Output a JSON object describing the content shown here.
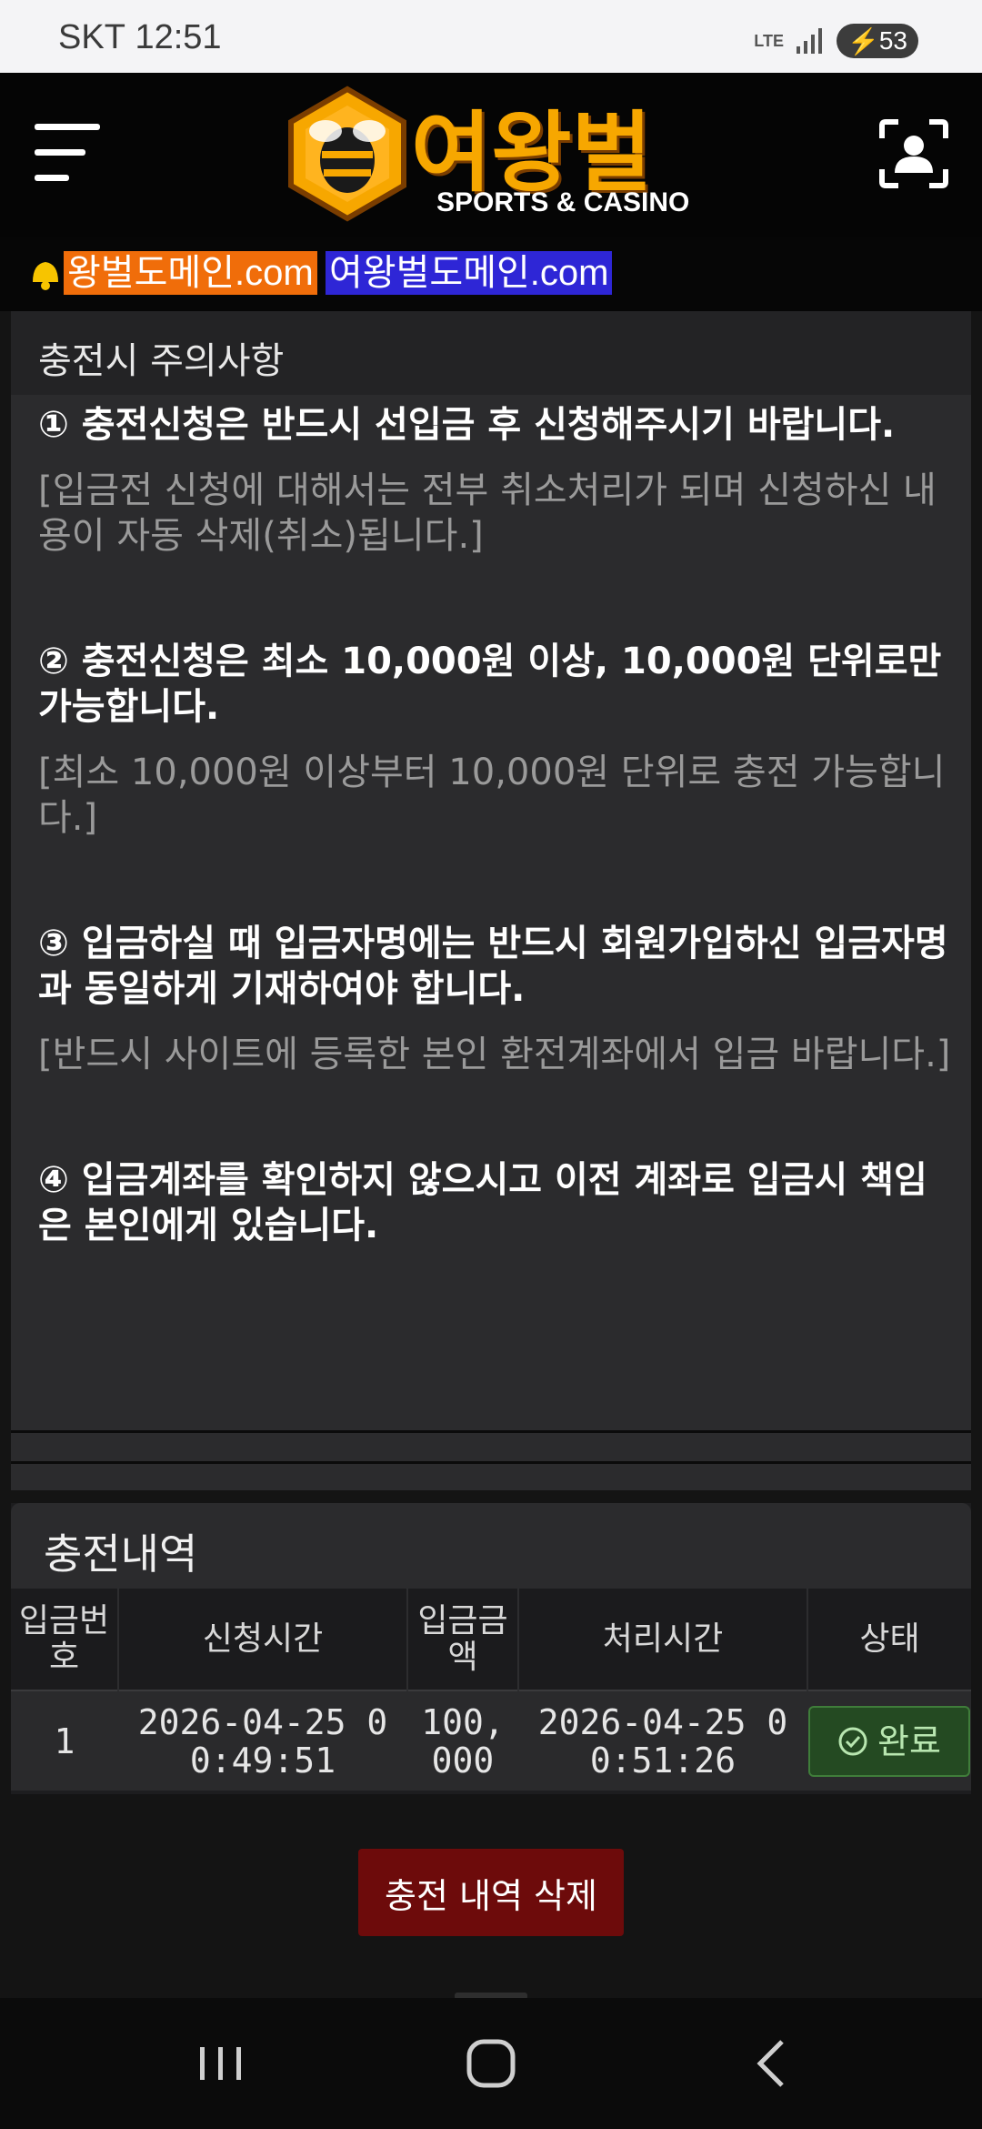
{
  "status": {
    "carrier": "SKT",
    "time": "12:51",
    "network": "LTE",
    "battery": "53"
  },
  "header": {
    "logo_text": "여왕벌",
    "logo_sub": "SPORTS & CASINO"
  },
  "domains": {
    "primary": "왕벌도메인.com",
    "secondary": "여왕벌도메인.com"
  },
  "notice": {
    "title": "충전시 주의사항",
    "items": [
      {
        "heading": "① 충전신청은 반드시 선입금 후 신청해주시기 바랍니다.",
        "sub": "[입금전 신청에 대해서는 전부 취소처리가 되며 신청하신 내용이 자동 삭제(취소)됩니다.]"
      },
      {
        "heading": "② 충전신청은 최소 10,000원 이상, 10,000원 단위로만 가능합니다.",
        "sub": "[최소 10,000원 이상부터 10,000원 단위로 충전 가능합니다.]"
      },
      {
        "heading": "③ 입금하실 때 입금자명에는 반드시 회원가입하신 입금자명과 동일하게 기재하여야 합니다.",
        "sub": "[반드시 사이트에 등록한 본인 환전계좌에서 입금 바랍니다.]"
      },
      {
        "heading": "④ 입금계좌를 확인하지 않으시고 이전 계좌로 입금시 책임은 본인에게 있습니다."
      }
    ]
  },
  "history": {
    "title": "충전내역",
    "columns": [
      "입금번호",
      "신청시간",
      "입금금액",
      "처리시간",
      "상태"
    ],
    "rows": [
      {
        "no": "1",
        "requested": "2026-04-25 00:49:51",
        "amount": "100,000",
        "processed": "2026-04-25 00:51:26",
        "status": "완료"
      }
    ]
  },
  "delete_label": "충전 내역 삭제",
  "colors": {
    "accent": "#f7a700",
    "delete": "#6d0b0b",
    "badge": "#244a22"
  }
}
